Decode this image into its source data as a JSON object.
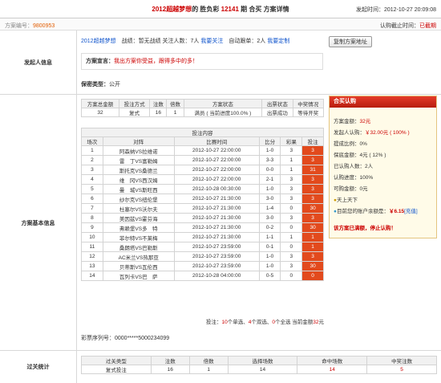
{
  "header": {
    "title_prefix": "2012超越梦想",
    "title_mid": "的 胜负彩",
    "issue": "12141",
    "title_suffix": "期 合买 方案详情",
    "publish_time": "发起时间：2012-10-27 20:09:08"
  },
  "subbar": {
    "scheme_no_label": "方案编号：",
    "scheme_no": "9800953",
    "deadline_label": "认购截止时间：",
    "deadline_value": "已截期"
  },
  "initiator": {
    "section_label": "发起人信息",
    "name": "2012超越梦想",
    "record_label": "战绩：",
    "record": "暂无战绩",
    "follow_label": "关注人数：",
    "follow_count": "7人",
    "follow_link": "我要关注",
    "auto_label": "自动跟单：",
    "auto_count": "2人",
    "auto_link": "我要定制",
    "copy_button": "复制方案地址",
    "manifesto_label": "方案宣言：",
    "manifesto": "我出方案你受益，跟得多中的多！"
  },
  "secrecy": {
    "label": "保密类型：",
    "value": "公开"
  },
  "scheme": {
    "section_label": "方案基本信息",
    "summary_headers": [
      "方案总金额",
      "投注方式",
      "注数",
      "倍数",
      "方案状态",
      "出票状态",
      "中奖情况"
    ],
    "summary_values": [
      "32",
      "复式",
      "16",
      "1",
      "满员 ( 当前进度100.0% )",
      "出票成功",
      "等待开奖"
    ],
    "content_title": "投注内容",
    "match_headers": [
      "场次",
      "对阵",
      "比赛时间",
      "比分",
      "彩果",
      "投注"
    ],
    "matches": [
      {
        "no": "1",
        "match": "阿森纳VS拉维诺",
        "time": "2012-10-27 22:00:00",
        "score": "1-0",
        "result": "3",
        "bet": "3"
      },
      {
        "no": "2",
        "match": "雷　丁VS富勒姆",
        "time": "2012-10-27 22:00:00",
        "score": "3-3",
        "result": "1",
        "bet": "3"
      },
      {
        "no": "3",
        "match": "斯托克VS桑德兰",
        "time": "2012-10-27 22:00:00",
        "score": "0-0",
        "result": "1",
        "bet": "31"
      },
      {
        "no": "4",
        "match": "维　冈VS西汉姆",
        "time": "2012-10-27 22:00:00",
        "score": "2-1",
        "result": "3",
        "bet": "3"
      },
      {
        "no": "5",
        "match": "曼　城VS斯旺西",
        "time": "2012-10-28 00:30:00",
        "score": "1-0",
        "result": "3",
        "bet": "3"
      },
      {
        "no": "6",
        "match": "纱尔克VS纽伦堡",
        "time": "2012-10-27 21:30:00",
        "score": "3-0",
        "result": "3",
        "bet": "3"
      },
      {
        "no": "7",
        "match": "杜塞尔VS沃尔夫",
        "time": "2012-10-27 21:30:00",
        "score": "1-4",
        "result": "0",
        "bet": "30"
      },
      {
        "no": "8",
        "match": "美因兹VS霍芬海",
        "time": "2012-10-27 21:30:00",
        "score": "3-0",
        "result": "3",
        "bet": "3"
      },
      {
        "no": "9",
        "match": "弗赖堡VS多　特",
        "time": "2012-10-27 21:30:00",
        "score": "0-2",
        "result": "0",
        "bet": "30"
      },
      {
        "no": "10",
        "match": "菲尔特VS不莱梅",
        "time": "2012-10-27 21:30:00",
        "score": "1-1",
        "result": "1",
        "bet": "1"
      },
      {
        "no": "11",
        "match": "桑朗塔VS巴勒斯",
        "time": "2012-10-27 23:59:00",
        "score": "0-1",
        "result": "0",
        "bet": "1"
      },
      {
        "no": "12",
        "match": "AC米兰VS热那亚",
        "time": "2012-10-27 23:59:00",
        "score": "1-0",
        "result": "3",
        "bet": "3"
      },
      {
        "no": "13",
        "match": "贝蒂斯VS瓦伦西",
        "time": "2012-10-27 23:59:00",
        "score": "1-0",
        "result": "3",
        "bet": "30"
      },
      {
        "no": "14",
        "match": "瓦列卡VS巴　萨",
        "time": "2012-10-28 04:00:00",
        "score": "0-5",
        "result": "0",
        "bet": "0"
      }
    ],
    "summary_line": {
      "a": "投注：",
      "b": "10",
      "c": "个单选、",
      "d": "4",
      "e": "个双选、",
      "f": "0",
      "g": "个全选 当前金额",
      "h": "32",
      "i": "元"
    },
    "ticket_label": "彩票序列号：",
    "ticket": "0000*****5000234099"
  },
  "side": {
    "title": "合买认购",
    "total_label": "方案金额：",
    "total": "32元",
    "starter_label": "发起人认购：",
    "starter": "￥32.00元 ( 100% )",
    "commission_label": "提成比例：",
    "commission": "0%",
    "guarantee_label": "保底金额：",
    "guarantee": "4元 ( 12% )",
    "bought_label": "已认购人数：",
    "bought": "2人",
    "progress_label": "认购进度：",
    "progress": "100%",
    "available_label": "可购金额：",
    "available": "0元",
    "user": "天上天下",
    "balance_label": "目前您的账户余额是：",
    "balance": "￥6.15",
    "recharge": "[充值]",
    "full_msg": "该方案已满额，停止认购！"
  },
  "pass": {
    "section_label": "过关统计",
    "headers": [
      "过关类型",
      "注数",
      "倍数",
      "选择场数",
      "命中场数",
      "中奖注数"
    ],
    "values": [
      "复式投注",
      "16",
      "1",
      "14",
      "14",
      "5"
    ]
  }
}
